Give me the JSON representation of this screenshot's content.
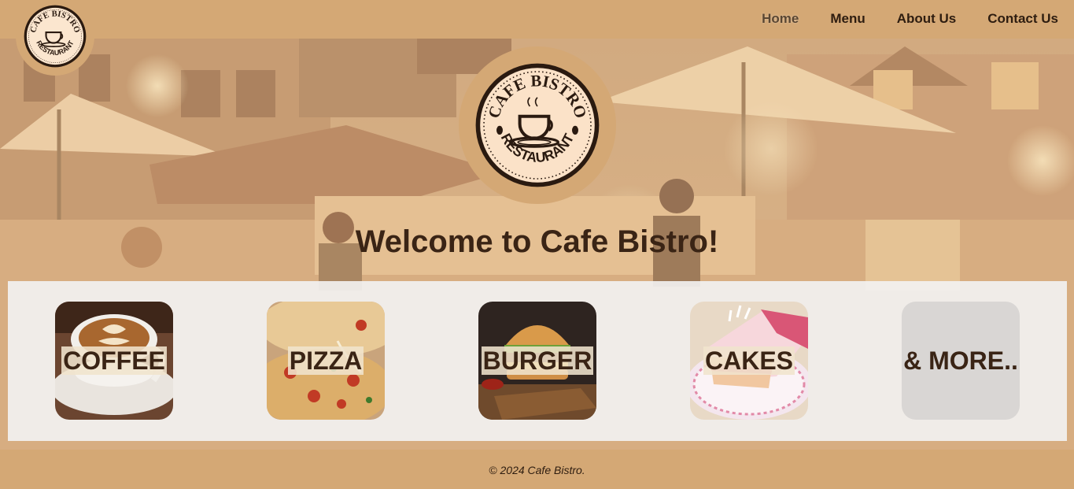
{
  "header": {
    "logo": {
      "icon": "cafe-bistro-logo",
      "top_text": "CAFE BISTRO",
      "bottom_text": "RESTAURANT"
    },
    "nav": [
      {
        "label": "Home",
        "active": true
      },
      {
        "label": "Menu",
        "active": false
      },
      {
        "label": "About Us",
        "active": false
      },
      {
        "label": "Contact Us",
        "active": false
      }
    ]
  },
  "hero": {
    "logo": {
      "icon": "cafe-bistro-logo",
      "top_text": "CAFE BISTRO",
      "bottom_text": "RESTAURANT"
    },
    "title": "Welcome to Cafe Bistro!",
    "categories": [
      {
        "label": "COFFEE",
        "image": "coffee-latte-image"
      },
      {
        "label": "PIZZA",
        "image": "pizza-image"
      },
      {
        "label": "BURGER",
        "image": "burger-image"
      },
      {
        "label": "CAKES",
        "image": "cake-slice-image"
      },
      {
        "label": "& MORE..",
        "image": ""
      }
    ]
  },
  "footer": {
    "text": "© 2024 Cafe Bistro."
  },
  "colors": {
    "brand": "#d4a875",
    "text_dark": "#3a2415",
    "panel": "#f3f3f3"
  }
}
